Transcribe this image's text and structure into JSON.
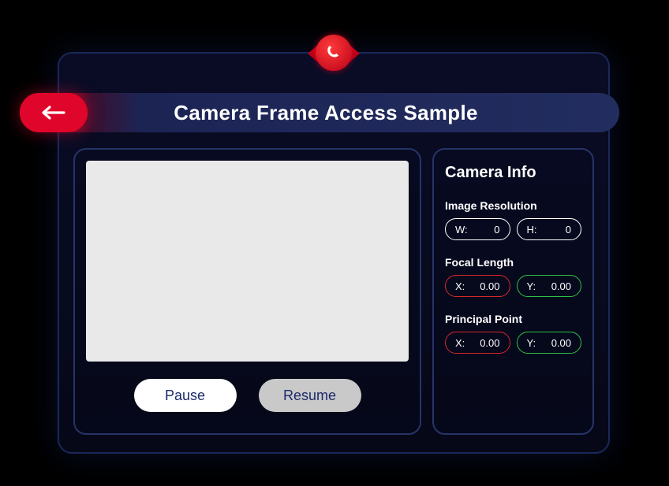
{
  "header": {
    "title": "Camera Frame Access Sample"
  },
  "controls": {
    "pause": "Pause",
    "resume": "Resume"
  },
  "info": {
    "title": "Camera Info",
    "resolution": {
      "label": "Image Resolution",
      "w_label": "W:",
      "w_value": "0",
      "h_label": "H:",
      "h_value": "0"
    },
    "focal": {
      "label": "Focal Length",
      "x_label": "X:",
      "x_value": "0.00",
      "y_label": "Y:",
      "y_value": "0.00"
    },
    "principal": {
      "label": "Principal Point",
      "x_label": "X:",
      "x_value": "0.00",
      "y_label": "Y:",
      "y_value": "0.00"
    }
  }
}
